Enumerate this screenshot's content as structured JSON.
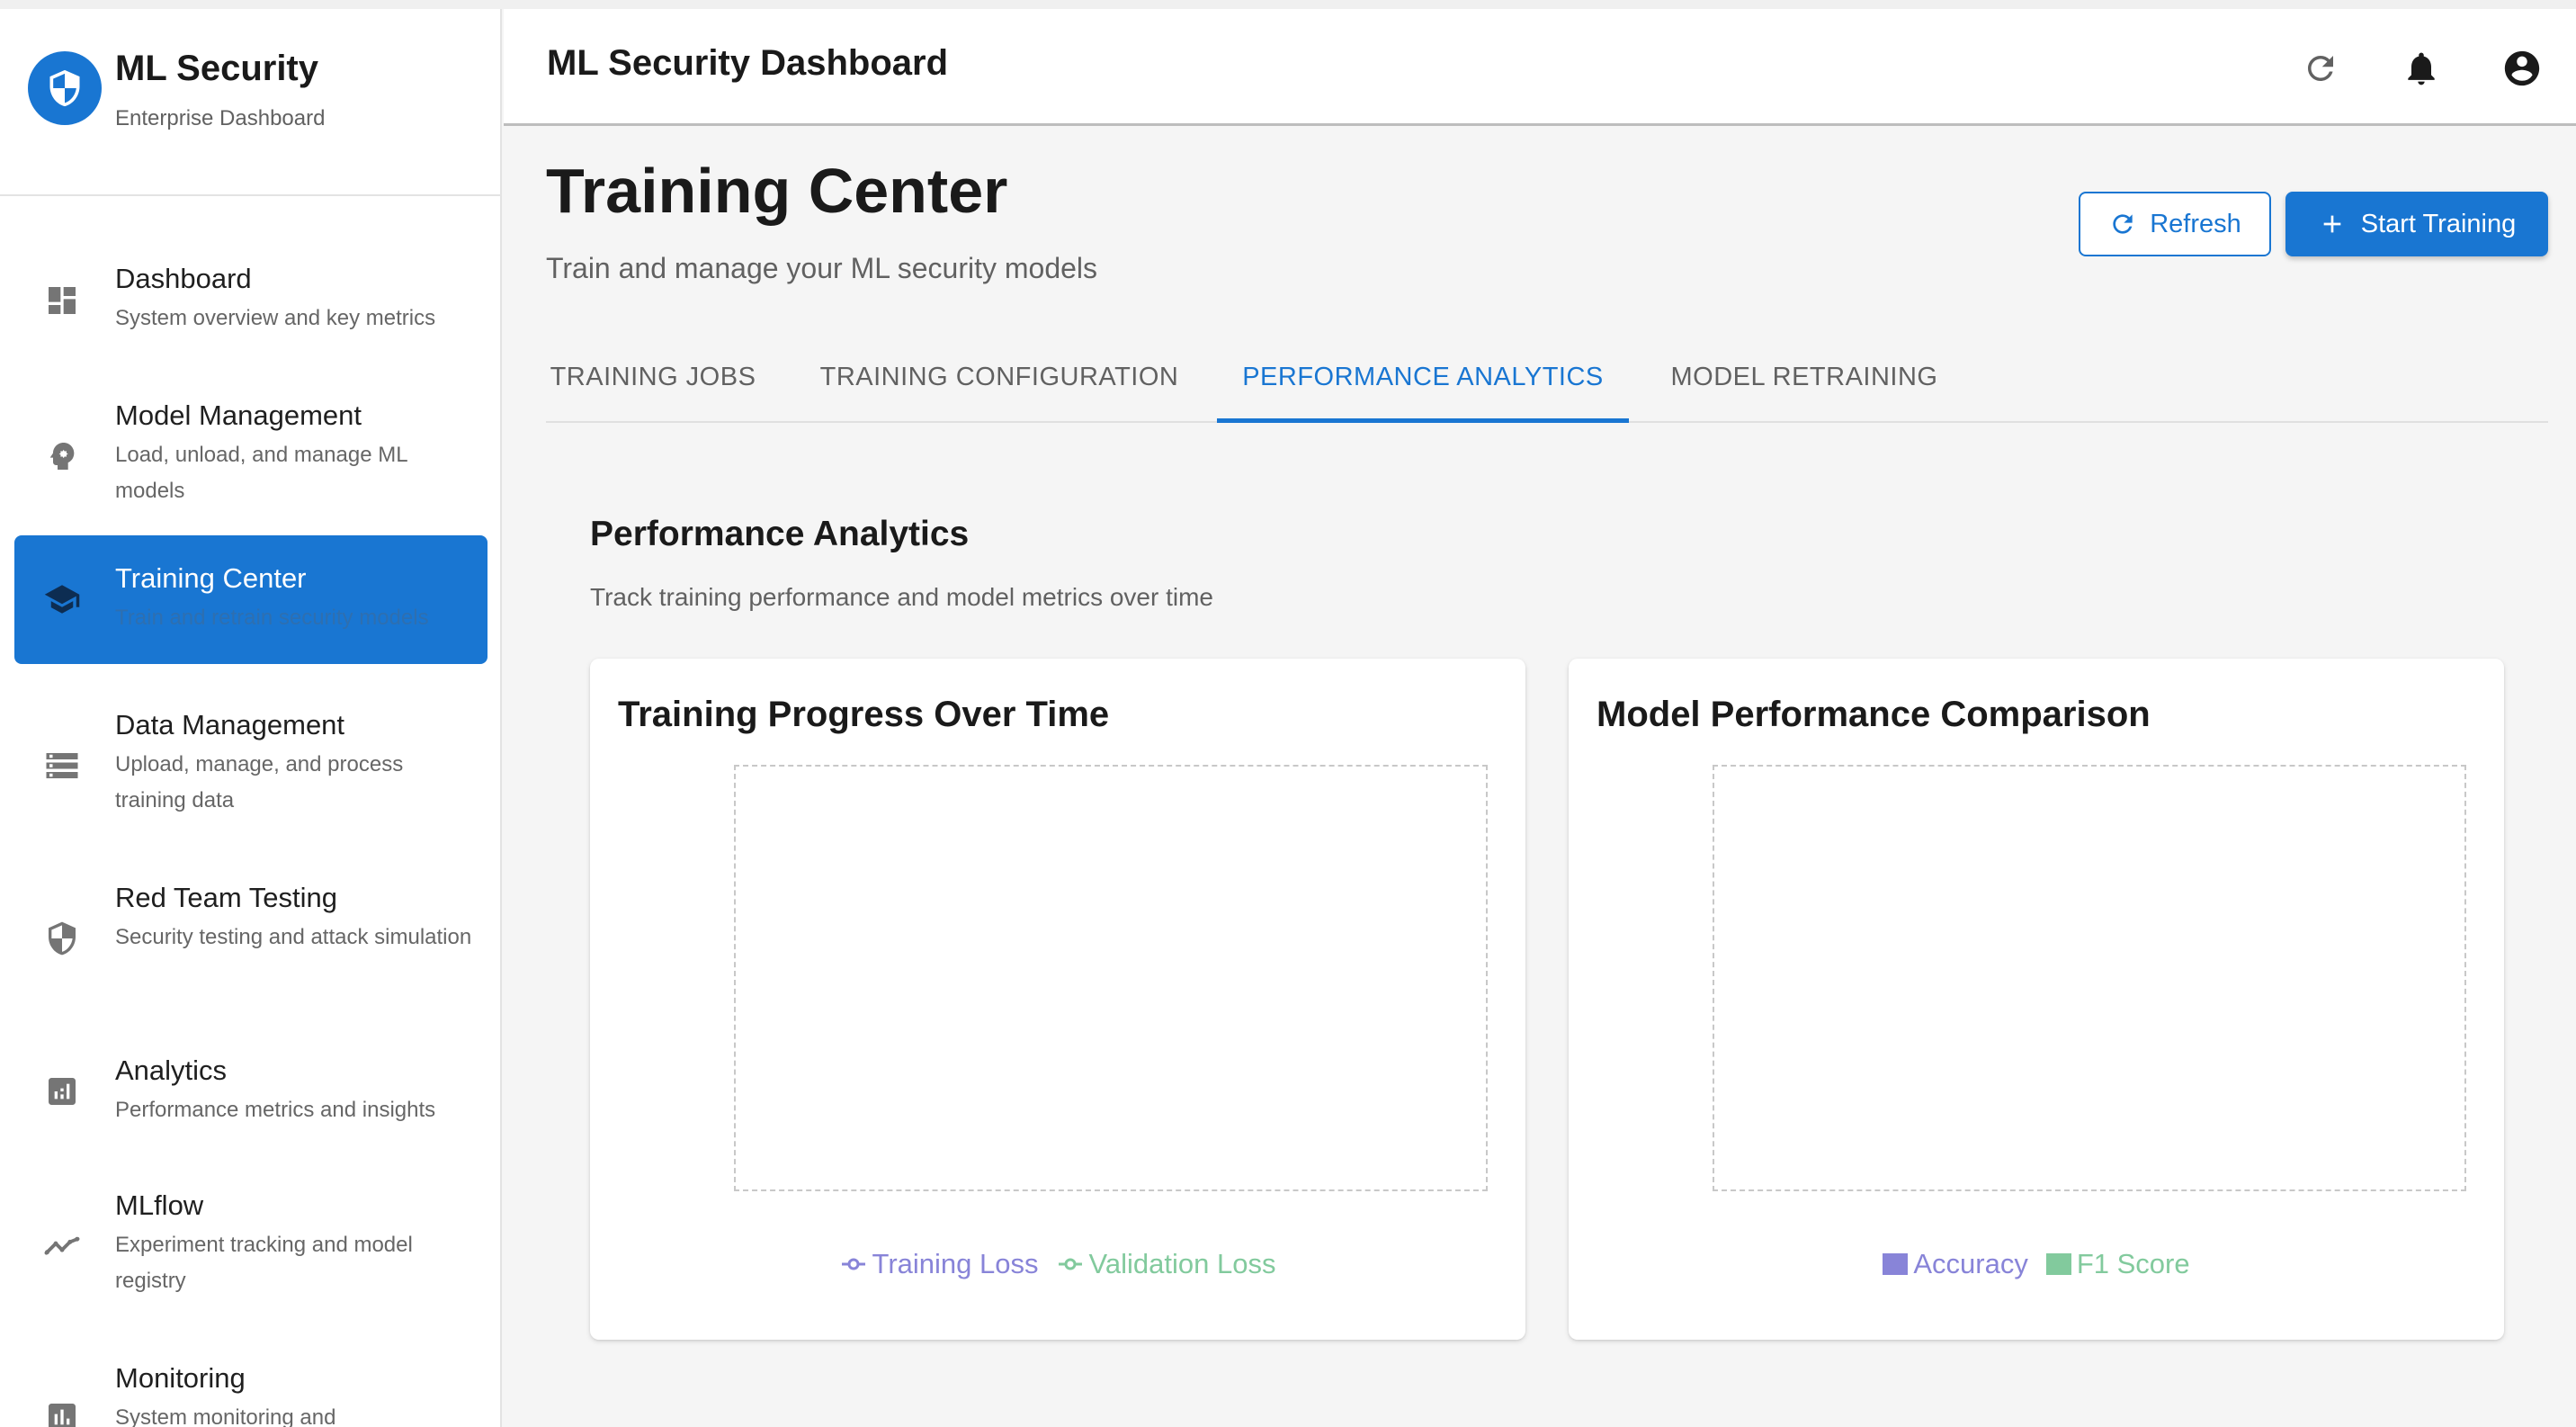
{
  "brand": {
    "title": "ML Security",
    "subtitle": "Enterprise Dashboard",
    "icon": "shield-icon"
  },
  "header": {
    "title": "ML Security Dashboard",
    "icons": [
      "refresh-icon",
      "bell-icon",
      "account-icon"
    ]
  },
  "sidebar": {
    "items": [
      {
        "label": "Dashboard",
        "description": "System overview and key metrics",
        "icon": "dashboard-icon",
        "active": false
      },
      {
        "label": "Model Management",
        "description": "Load, unload, and manage ML models",
        "icon": "model-settings-icon",
        "active": false
      },
      {
        "label": "Training Center",
        "description": "Train and retrain security models",
        "icon": "school-icon",
        "active": true
      },
      {
        "label": "Data Management",
        "description": "Upload, manage, and process training data",
        "icon": "storage-icon",
        "active": false
      },
      {
        "label": "Red Team Testing",
        "description": "Security testing and attack simulation",
        "icon": "security-icon",
        "active": false
      },
      {
        "label": "Analytics",
        "description": "Performance metrics and insights",
        "icon": "analytics-icon",
        "active": false
      },
      {
        "label": "MLflow",
        "description": "Experiment tracking and model registry",
        "icon": "timeline-icon",
        "active": false
      },
      {
        "label": "Monitoring",
        "description": "System monitoring and",
        "icon": "bar-chart-icon",
        "active": false
      }
    ]
  },
  "page": {
    "title": "Training Center",
    "subtitle": "Train and manage your ML security models"
  },
  "actions": {
    "refresh_label": "Refresh",
    "start_label": "Start Training"
  },
  "tabs": [
    {
      "label": "TRAINING JOBS",
      "active": false
    },
    {
      "label": "TRAINING CONFIGURATION",
      "active": false
    },
    {
      "label": "PERFORMANCE ANALYTICS",
      "active": true
    },
    {
      "label": "MODEL RETRAINING",
      "active": false
    }
  ],
  "section": {
    "title": "Performance Analytics",
    "subtitle": "Track training performance and model metrics over time"
  },
  "colors": {
    "primary": "#1976d2",
    "series_purple": "#8884d8",
    "series_green": "#82ca9d"
  },
  "chart_data": [
    {
      "type": "line",
      "title": "Training Progress Over Time",
      "series": [
        {
          "name": "Training Loss",
          "color": "#8884d8",
          "values": []
        },
        {
          "name": "Validation Loss",
          "color": "#82ca9d",
          "values": []
        }
      ]
    },
    {
      "type": "bar",
      "title": "Model Performance Comparison",
      "series": [
        {
          "name": "Accuracy",
          "color": "#8884d8",
          "values": []
        },
        {
          "name": "F1 Score",
          "color": "#82ca9d",
          "values": []
        }
      ]
    }
  ]
}
